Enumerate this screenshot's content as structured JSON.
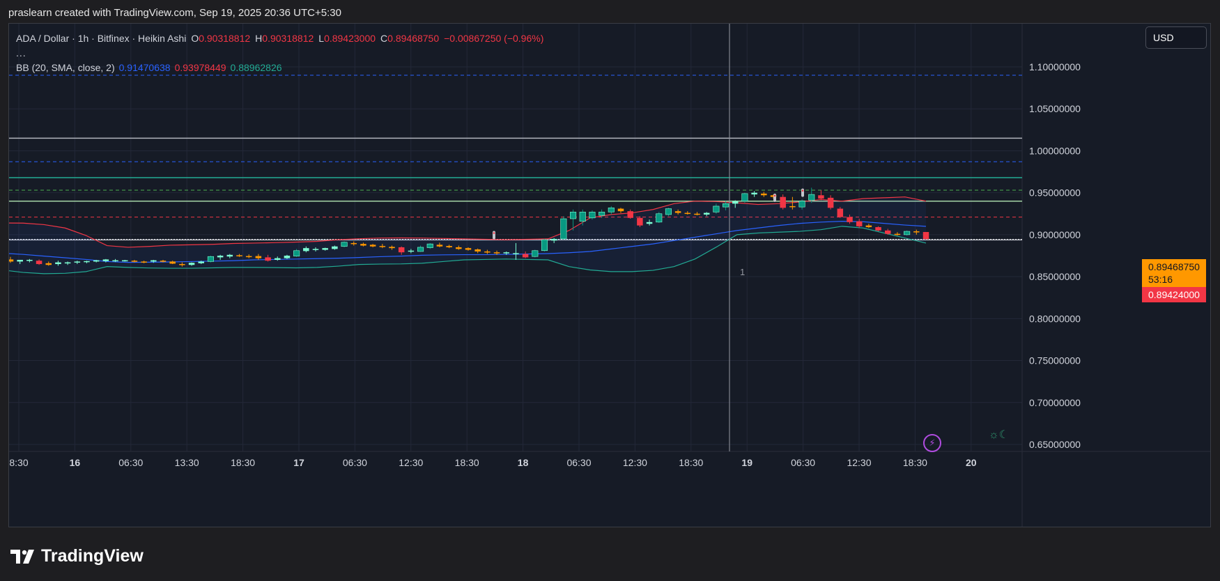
{
  "caption": "praslearn created with TradingView.com, Sep 19, 2025 20:36 UTC+5:30",
  "legend": {
    "symbol": "ADA / Dollar · 1h · Bitfinex · Heikin Ashi",
    "open_label": "O",
    "open": "0.90318812",
    "high_label": "H",
    "high": "0.90318812",
    "low_label": "L",
    "low": "0.89423000",
    "close_label": "C",
    "close": "0.89468750",
    "change": "−0.00867250 (−0.96%)",
    "more": "...",
    "bb_label": "BB (20, SMA, close, 2)",
    "bb_basis": "0.91470638",
    "bb_upper": "0.93978449",
    "bb_lower": "0.88962826"
  },
  "currency_button": "USD",
  "price_tags": {
    "current": "0.89468750",
    "countdown": "53:16",
    "low": "0.89424000"
  },
  "crosshair_label": "1",
  "brand": {
    "name": "TradingView"
  },
  "colors": {
    "background": "#161b26",
    "bull": "#7fffd4",
    "bull_strong": "#089981",
    "bear": "#ff9800",
    "bear_strong": "#f23645",
    "bb_basis": "#2962ff",
    "bb_upper": "#f23645",
    "bb_lower": "#22ab94"
  },
  "icons": [
    "flash-icon",
    "sun-moon-icon",
    "tradingview-logo-icon"
  ],
  "chart_data": {
    "type": "candlestick",
    "style": "Heikin Ashi",
    "interval": "1h",
    "price_axis": {
      "ticks": [
        "1.10000000",
        "1.05000000",
        "1.00000000",
        "0.95000000",
        "0.90000000",
        "0.85000000",
        "0.80000000",
        "0.75000000",
        "0.70000000",
        "0.65000000"
      ],
      "ylim": [
        0.64,
        1.12
      ]
    },
    "time_axis": {
      "ticks": [
        "8:30",
        "16",
        "06:30",
        "13:30",
        "18:30",
        "17",
        "06:30",
        "12:30",
        "18:30",
        "18",
        "06:30",
        "12:30",
        "18:30",
        "19",
        "06:30",
        "12:30",
        "18:30",
        "20"
      ],
      "bold": [
        false,
        true,
        false,
        false,
        false,
        true,
        false,
        false,
        false,
        true,
        false,
        false,
        false,
        true,
        false,
        false,
        false,
        true
      ]
    },
    "horizontal_lines": [
      {
        "price": 1.09,
        "style": "dashed",
        "color": "#2962ff"
      },
      {
        "price": 1.015,
        "style": "solid",
        "color": "#b2b5be"
      },
      {
        "price": 0.987,
        "style": "dashed",
        "color": "#2962ff"
      },
      {
        "price": 0.968,
        "style": "solid",
        "color": "#22ab94"
      },
      {
        "price": 0.953,
        "style": "dashed",
        "color": "#4caf50"
      },
      {
        "price": 0.94,
        "style": "solid",
        "color": "#a5d6a7"
      },
      {
        "price": 0.921,
        "style": "dashed",
        "color": "#f23645"
      },
      {
        "price": 0.8945,
        "style": "dotted",
        "color": "#ffffff"
      },
      {
        "price": 0.8938,
        "style": "solid",
        "color": "#b2b5be"
      }
    ],
    "candles": [
      [
        0.8705,
        0.8735,
        0.8665,
        0.868
      ],
      [
        0.868,
        0.87,
        0.865,
        0.87
      ],
      [
        0.869,
        0.871,
        0.867,
        0.87
      ],
      [
        0.869,
        0.8705,
        0.864,
        0.865
      ],
      [
        0.866,
        0.868,
        0.863,
        0.864
      ],
      [
        0.865,
        0.869,
        0.863,
        0.867
      ],
      [
        0.866,
        0.868,
        0.864,
        0.867
      ],
      [
        0.867,
        0.869,
        0.865,
        0.868
      ],
      [
        0.8675,
        0.869,
        0.866,
        0.8685
      ],
      [
        0.868,
        0.87,
        0.867,
        0.8695
      ],
      [
        0.8685,
        0.871,
        0.867,
        0.8705
      ],
      [
        0.869,
        0.871,
        0.8675,
        0.8695
      ],
      [
        0.869,
        0.87,
        0.868,
        0.8695
      ],
      [
        0.869,
        0.87,
        0.867,
        0.868
      ],
      [
        0.868,
        0.869,
        0.866,
        0.8675
      ],
      [
        0.868,
        0.87,
        0.8665,
        0.8695
      ],
      [
        0.869,
        0.87,
        0.867,
        0.868
      ],
      [
        0.868,
        0.869,
        0.865,
        0.8655
      ],
      [
        0.865,
        0.867,
        0.862,
        0.864
      ],
      [
        0.864,
        0.867,
        0.863,
        0.8665
      ],
      [
        0.866,
        0.869,
        0.865,
        0.868
      ],
      [
        0.868,
        0.875,
        0.867,
        0.874
      ],
      [
        0.873,
        0.876,
        0.87,
        0.875
      ],
      [
        0.874,
        0.877,
        0.872,
        0.876
      ],
      [
        0.8755,
        0.877,
        0.8735,
        0.8745
      ],
      [
        0.8745,
        0.8765,
        0.872,
        0.8735
      ],
      [
        0.8745,
        0.877,
        0.87,
        0.872
      ],
      [
        0.873,
        0.876,
        0.868,
        0.869
      ],
      [
        0.87,
        0.874,
        0.869,
        0.872
      ],
      [
        0.872,
        0.876,
        0.871,
        0.875
      ],
      [
        0.8745,
        0.883,
        0.8735,
        0.881
      ],
      [
        0.8805,
        0.886,
        0.879,
        0.884
      ],
      [
        0.882,
        0.885,
        0.88,
        0.883
      ],
      [
        0.882,
        0.8845,
        0.881,
        0.884
      ],
      [
        0.883,
        0.887,
        0.882,
        0.886
      ],
      [
        0.886,
        0.892,
        0.885,
        0.891
      ],
      [
        0.89,
        0.892,
        0.887,
        0.889
      ],
      [
        0.889,
        0.8905,
        0.886,
        0.887
      ],
      [
        0.888,
        0.889,
        0.885,
        0.886
      ],
      [
        0.8865,
        0.889,
        0.884,
        0.8855
      ],
      [
        0.8855,
        0.887,
        0.882,
        0.884
      ],
      [
        0.885,
        0.886,
        0.876,
        0.879
      ],
      [
        0.88,
        0.883,
        0.878,
        0.881
      ],
      [
        0.88,
        0.887,
        0.8795,
        0.885
      ],
      [
        0.8845,
        0.89,
        0.883,
        0.889
      ],
      [
        0.888,
        0.8905,
        0.885,
        0.886
      ],
      [
        0.8865,
        0.888,
        0.884,
        0.885
      ],
      [
        0.885,
        0.887,
        0.882,
        0.883
      ],
      [
        0.884,
        0.885,
        0.881,
        0.882
      ],
      [
        0.8825,
        0.8835,
        0.878,
        0.88
      ],
      [
        0.88,
        0.882,
        0.877,
        0.879
      ],
      [
        0.879,
        0.881,
        0.876,
        0.878
      ],
      [
        0.878,
        0.88,
        0.876,
        0.879
      ],
      [
        0.878,
        0.89,
        0.87,
        0.878
      ],
      [
        0.877,
        0.88,
        0.872,
        0.873
      ],
      [
        0.874,
        0.882,
        0.873,
        0.881
      ],
      [
        0.881,
        0.895,
        0.88,
        0.894
      ],
      [
        0.893,
        0.896,
        0.89,
        0.895
      ],
      [
        0.895,
        0.922,
        0.894,
        0.919
      ],
      [
        0.919,
        0.93,
        0.905,
        0.927
      ],
      [
        0.916,
        0.93,
        0.911,
        0.927
      ],
      [
        0.92,
        0.929,
        0.918,
        0.927
      ],
      [
        0.923,
        0.93,
        0.92,
        0.927
      ],
      [
        0.927,
        0.934,
        0.924,
        0.932
      ],
      [
        0.931,
        0.932,
        0.926,
        0.928
      ],
      [
        0.928,
        0.93,
        0.919,
        0.92
      ],
      [
        0.92,
        0.922,
        0.909,
        0.911
      ],
      [
        0.913,
        0.918,
        0.911,
        0.915
      ],
      [
        0.915,
        0.927,
        0.914,
        0.925
      ],
      [
        0.924,
        0.932,
        0.922,
        0.931
      ],
      [
        0.928,
        0.93,
        0.924,
        0.926
      ],
      [
        0.926,
        0.928,
        0.924,
        0.925
      ],
      [
        0.925,
        0.927,
        0.923,
        0.924
      ],
      [
        0.924,
        0.927,
        0.922,
        0.926
      ],
      [
        0.927,
        0.937,
        0.925,
        0.934
      ],
      [
        0.933,
        0.94,
        0.929,
        0.937
      ],
      [
        0.937,
        0.941,
        0.932,
        0.94
      ],
      [
        0.94,
        0.95,
        0.938,
        0.949
      ],
      [
        0.948,
        0.952,
        0.945,
        0.95
      ],
      [
        0.949,
        0.951,
        0.945,
        0.947
      ],
      [
        0.947,
        0.948,
        0.943,
        0.945
      ],
      [
        0.945,
        0.948,
        0.93,
        0.932
      ],
      [
        0.934,
        0.945,
        0.93,
        0.933
      ],
      [
        0.933,
        0.942,
        0.93,
        0.94
      ],
      [
        0.941,
        0.956,
        0.938,
        0.948
      ],
      [
        0.947,
        0.953,
        0.941,
        0.943
      ],
      [
        0.944,
        0.947,
        0.93,
        0.932
      ],
      [
        0.931,
        0.933,
        0.92,
        0.921
      ],
      [
        0.921,
        0.924,
        0.913,
        0.915
      ],
      [
        0.916,
        0.919,
        0.908,
        0.91
      ],
      [
        0.911,
        0.913,
        0.908,
        0.909
      ],
      [
        0.909,
        0.91,
        0.904,
        0.905
      ],
      [
        0.905,
        0.907,
        0.9,
        0.901
      ],
      [
        0.901,
        0.903,
        0.899,
        0.9
      ],
      [
        0.9,
        0.905,
        0.899,
        0.904
      ],
      [
        0.904,
        0.906,
        0.9,
        0.903
      ],
      [
        0.9032,
        0.9032,
        0.8942,
        0.8947
      ]
    ],
    "bollinger_bands": {
      "period": 20,
      "ma": "SMA",
      "source": "close",
      "stddev": 2,
      "basis": [
        0.878,
        0.8765,
        0.8745,
        0.8725,
        0.8705,
        0.868,
        0.867,
        0.8672,
        0.8675,
        0.868,
        0.8685,
        0.869,
        0.87,
        0.8705,
        0.871,
        0.8715,
        0.872,
        0.8728,
        0.8738,
        0.8745,
        0.8755,
        0.876,
        0.8762,
        0.8762,
        0.8765,
        0.877,
        0.8775,
        0.8785,
        0.88,
        0.883,
        0.886,
        0.889,
        0.893,
        0.897,
        0.901,
        0.905,
        0.908,
        0.911,
        0.9135,
        0.915,
        0.916,
        0.9155,
        0.9135,
        0.9115,
        0.91
      ],
      "upper": [
        0.914,
        0.9138,
        0.912,
        0.908,
        0.899,
        0.887,
        0.885,
        0.886,
        0.8875,
        0.888,
        0.8885,
        0.8895,
        0.89,
        0.8905,
        0.8912,
        0.892,
        0.894,
        0.8952,
        0.896,
        0.8962,
        0.896,
        0.8955,
        0.895,
        0.8945,
        0.894,
        0.8945,
        0.895,
        0.905,
        0.92,
        0.924,
        0.926,
        0.93,
        0.937,
        0.94,
        0.9395,
        0.938,
        0.936,
        0.937,
        0.939,
        0.942,
        0.94,
        0.943,
        0.944,
        0.945,
        0.94
      ],
      "lower": [
        0.858,
        0.855,
        0.8535,
        0.854,
        0.856,
        0.862,
        0.861,
        0.8603,
        0.86,
        0.86,
        0.8605,
        0.861,
        0.861,
        0.8608,
        0.8605,
        0.861,
        0.8625,
        0.8645,
        0.865,
        0.8652,
        0.866,
        0.868,
        0.87,
        0.8705,
        0.871,
        0.8705,
        0.87,
        0.862,
        0.858,
        0.856,
        0.856,
        0.8575,
        0.862,
        0.871,
        0.885,
        0.9,
        0.902,
        0.903,
        0.904,
        0.906,
        0.91,
        0.908,
        0.902,
        0.896,
        0.89
      ]
    }
  }
}
